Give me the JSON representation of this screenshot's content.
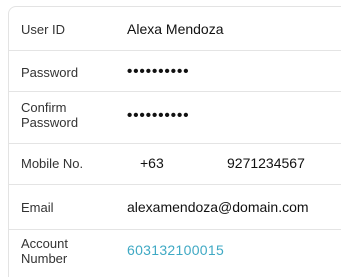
{
  "form": {
    "user_id": {
      "label": "User ID",
      "value": "Alexa Mendoza"
    },
    "password": {
      "label": "Password",
      "value": "••••••••••"
    },
    "confirm_password": {
      "label": "Confirm\nPassword",
      "value": "••••••••••"
    },
    "mobile": {
      "label": "Mobile No.",
      "country_code": "+63",
      "number": "9271234567"
    },
    "email": {
      "label": "Email",
      "value": "alexamendoza@domain.com"
    },
    "account_number": {
      "label": "Account\nNumber",
      "value": "603132100015"
    }
  },
  "colors": {
    "link": "#3fa9c4",
    "divider": "#e4e4e4",
    "text": "#111111",
    "label": "#333333"
  }
}
